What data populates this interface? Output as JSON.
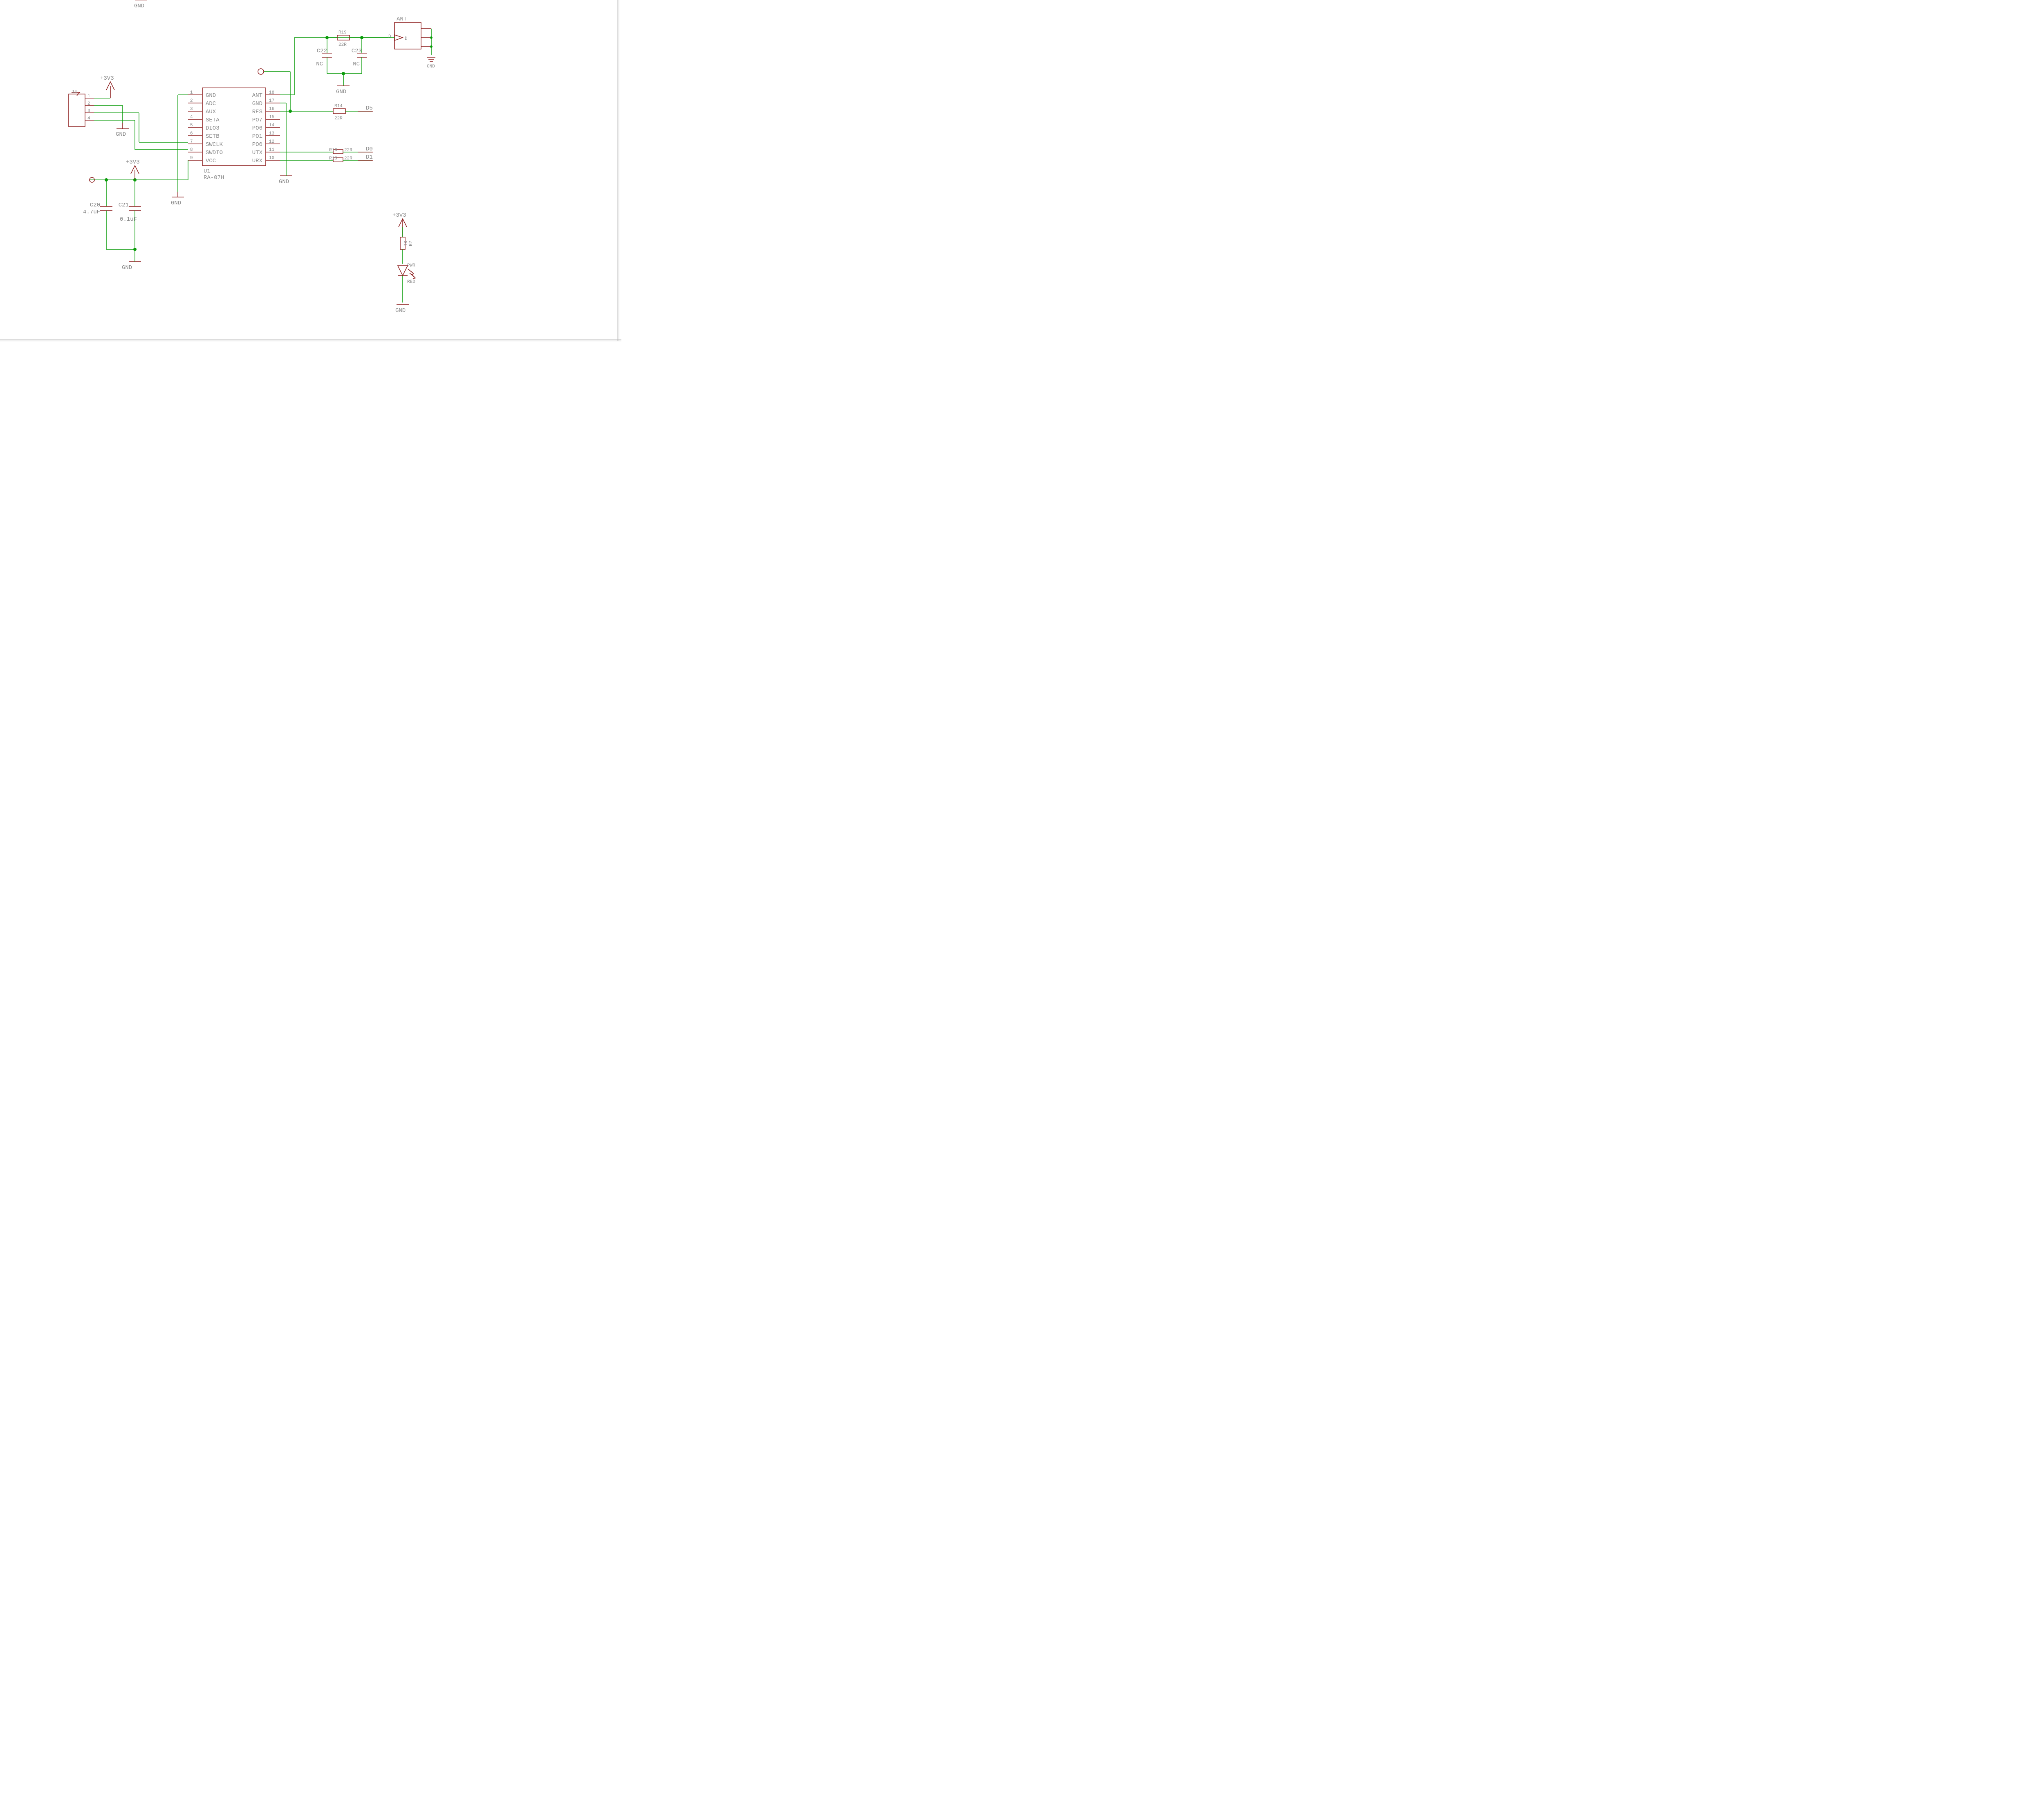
{
  "ic": {
    "ref": "U1",
    "part": "RA-07H",
    "left_pins": [
      {
        "num": "1",
        "name": "GND"
      },
      {
        "num": "2",
        "name": "ADC"
      },
      {
        "num": "3",
        "name": "AUX"
      },
      {
        "num": "4",
        "name": "SETA"
      },
      {
        "num": "5",
        "name": "DIO3"
      },
      {
        "num": "6",
        "name": "SETB"
      },
      {
        "num": "7",
        "name": "SWCLK"
      },
      {
        "num": "8",
        "name": "SWDIO"
      },
      {
        "num": "9",
        "name": "VCC"
      }
    ],
    "right_pins": [
      {
        "num": "18",
        "name": "ANT"
      },
      {
        "num": "17",
        "name": "GND"
      },
      {
        "num": "16",
        "name": "RES"
      },
      {
        "num": "15",
        "name": "PO7"
      },
      {
        "num": "14",
        "name": "PO6"
      },
      {
        "num": "13",
        "name": "PO1"
      },
      {
        "num": "12",
        "name": "PO0"
      },
      {
        "num": "11",
        "name": "UTX"
      },
      {
        "num": "10",
        "name": "URX"
      }
    ]
  },
  "power": {
    "p3v3_top": "+3V3",
    "p3v3_left": "+3V3",
    "p3v3_led": "+3V3",
    "gnd": "GND"
  },
  "caps": {
    "c20": {
      "ref": "C20",
      "val": "4.7uF"
    },
    "c21": {
      "ref": "C21",
      "val": "0.1uF"
    },
    "c22": {
      "ref": "C22",
      "val": "NC"
    },
    "c23": {
      "ref": "C23",
      "val": "NC"
    }
  },
  "res": {
    "r19": {
      "ref": "R19",
      "val": "22R"
    },
    "r14": {
      "ref": "R14",
      "val": "22R"
    },
    "r16": {
      "ref": "R16",
      "val": "22R"
    },
    "r18": {
      "ref": "R18",
      "val": "22R"
    },
    "r7": {
      "ref": "R7",
      "val": "1K"
    }
  },
  "conn": {
    "ant": {
      "ref": "ANT",
      "pin": "D",
      "gnd": "GND"
    },
    "j4": {
      "ref": "J4",
      "pins": [
        "1",
        "2",
        "3",
        "4"
      ]
    }
  },
  "led": {
    "ref": "PWR",
    "val": "RED"
  },
  "nets": {
    "d5": "D5",
    "d0": "D0",
    "d1": "D1",
    "d_ant": "D"
  }
}
